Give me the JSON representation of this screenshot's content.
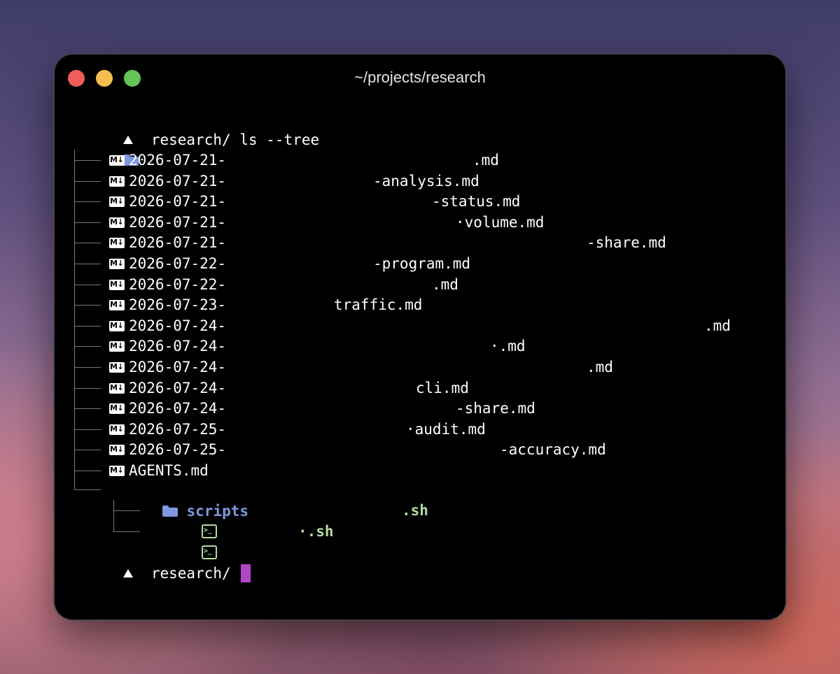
{
  "window": {
    "title": "~/projects/research"
  },
  "prompt": {
    "cwd": "research/",
    "command": "ls --tree"
  },
  "root": {
    "label": "."
  },
  "files": [
    {
      "prefix": "2026-07-21-",
      "suffix": ".md"
    },
    {
      "prefix": "2026-07-21-",
      "suffix": "-analysis.md"
    },
    {
      "prefix": "2026-07-21-",
      "suffix": "-status.md"
    },
    {
      "prefix": "2026-07-21-",
      "suffix": "·volume.md"
    },
    {
      "prefix": "2026-07-21-",
      "suffix": "-share.md"
    },
    {
      "prefix": "2026-07-22-",
      "suffix": "-program.md"
    },
    {
      "prefix": "2026-07-22-",
      "suffix": ".md"
    },
    {
      "prefix": "2026-07-23-",
      "suffix": "traffic.md"
    },
    {
      "prefix": "2026-07-24-",
      "suffix": ".md"
    },
    {
      "prefix": "2026-07-24-",
      "suffix": "·.md"
    },
    {
      "prefix": "2026-07-24-",
      "suffix": ".md"
    },
    {
      "prefix": "2026-07-24-",
      "suffix": "cli.md"
    },
    {
      "prefix": "2026-07-24-",
      "suffix": "-share.md"
    },
    {
      "prefix": "2026-07-25-",
      "suffix": "·audit.md"
    },
    {
      "prefix": "2026-07-25-",
      "suffix": "-accuracy.md"
    },
    {
      "prefix": "AGENTS.md",
      "suffix": ""
    }
  ],
  "scripts_folder": {
    "label": "scripts"
  },
  "scripts": [
    {
      "suffix": ".sh"
    },
    {
      "suffix": "·.sh"
    }
  ],
  "prompt_end": {
    "cwd": "research/"
  },
  "colors": {
    "folder": "#7e97e0",
    "script": "#b4dba0",
    "cursor": "#b245c4",
    "close": "#ee5f5b",
    "minimize": "#f4bf4f",
    "maximize": "#62c554"
  },
  "icons": {
    "markdown": "markdown-icon",
    "folder": "folder-icon",
    "script": "terminal-icon"
  }
}
